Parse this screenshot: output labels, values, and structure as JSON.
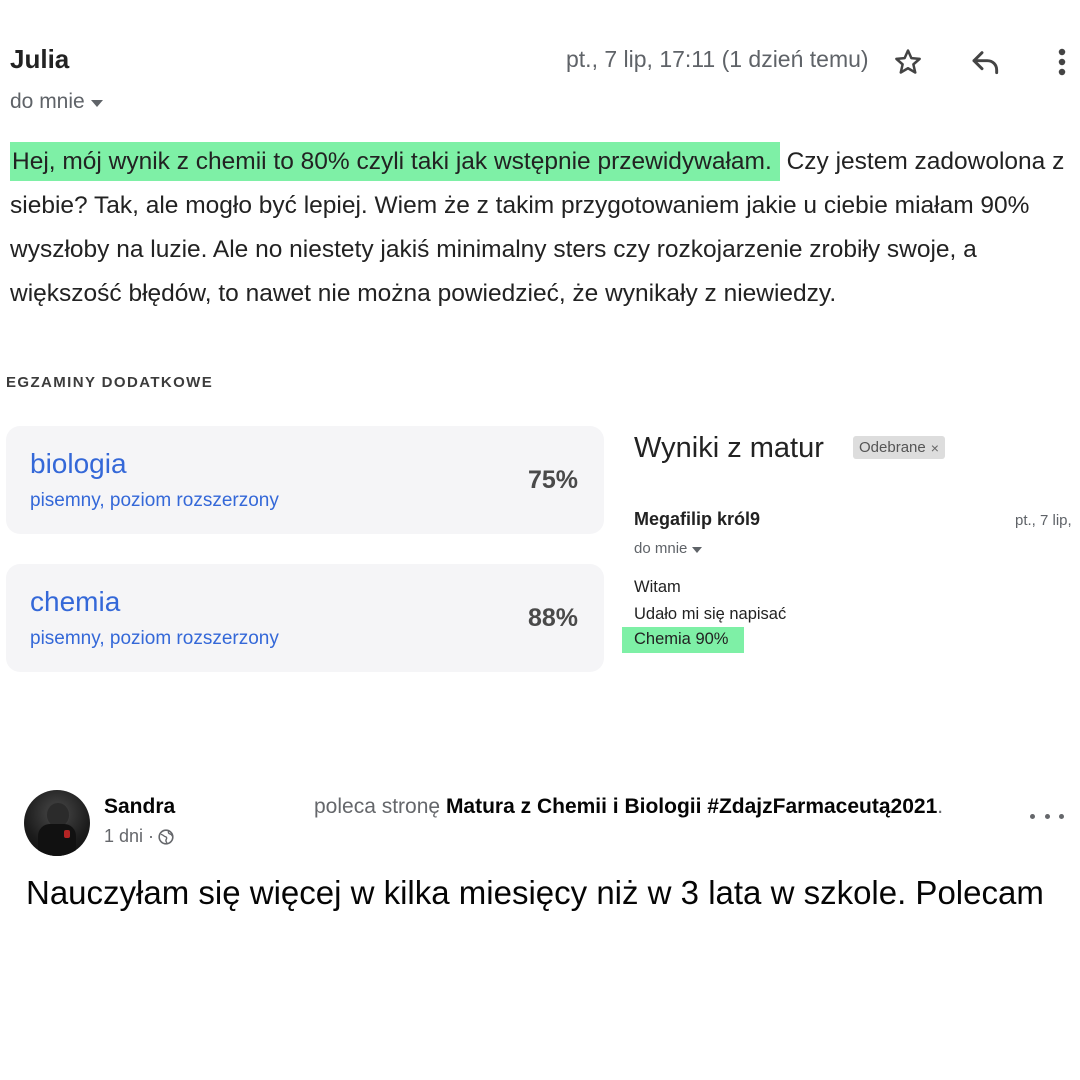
{
  "email1": {
    "sender": "Julia",
    "date": "pt., 7 lip, 17:11 (1 dzień temu)",
    "to": "do mnie",
    "body_highlight": "Hej, mój wynik z chemii to 80% czyli taki jak wstępnie przewidywałam.",
    "body_rest": " Czy jestem zadowolona z siebie? Tak, ale mogło być lepiej. Wiem że z takim przygotowaniem jakie u ciebie miałam 90% wyszłoby na luzie. Ale no niestety jakiś minimalny sters czy rozkojarzenie zrobiły swoje, a większość błędów, to nawet nie można powiedzieć, że wynikały z niewiedzy."
  },
  "exams": {
    "section_title": "EGZAMINY DODATKOWE",
    "items": [
      {
        "subject": "biologia",
        "level": "pisemny, poziom rozszerzony",
        "score": "75%"
      },
      {
        "subject": "chemia",
        "level": "pisemny, poziom rozszerzony",
        "score": "88%"
      }
    ]
  },
  "email2": {
    "subject": "Wyniki z matur",
    "label": "Odebrane",
    "label_close": "×",
    "sender": "Megafilip król9",
    "date": "pt., 7 lip,",
    "to": "do mnie",
    "lines": [
      "Witam",
      "Udało mi się napisać",
      "Chemia 90%"
    ]
  },
  "fb_post": {
    "author": "Sandra",
    "recommends_prefix": "poleca stronę",
    "page_name": "Matura z Chemii i Biologii #ZdajzFarmaceutą2021",
    "recommends_suffix": ".",
    "time": "1 dni ·",
    "text": "Nauczyłam się więcej w kilka miesięcy niż w 3 lata w szkole. Polecam",
    "icons": {
      "privacy": "globe-icon",
      "menu": "more-horizontal-icon"
    }
  },
  "colors": {
    "highlight": "#7ef0a6",
    "exam_blue": "#3468d8",
    "card_bg": "#f5f5f7",
    "meta_gray": "#5f6368"
  }
}
